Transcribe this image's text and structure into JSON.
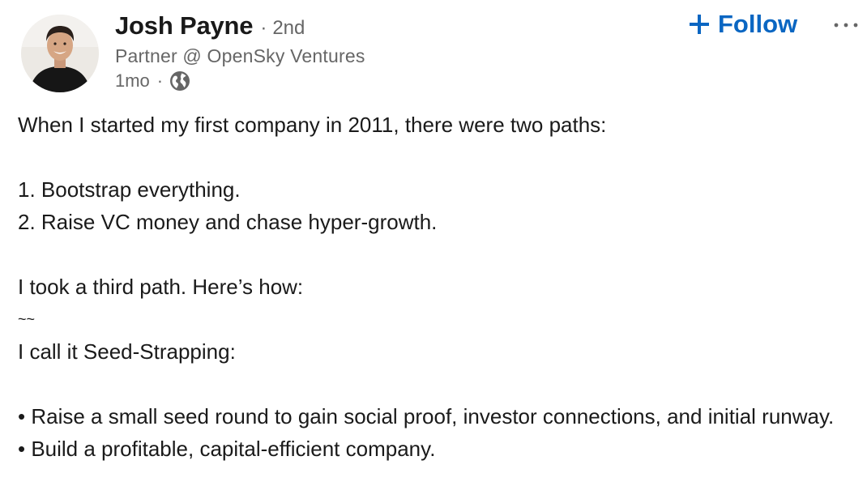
{
  "author": {
    "name": "Josh Payne",
    "degree_separator": "·",
    "degree": "2nd",
    "headline": "Partner @ OpenSky Ventures",
    "time": "1mo",
    "meta_separator": "·",
    "visibility_icon": "globe-icon",
    "avatar_icon": "avatar-photo"
  },
  "actions": {
    "follow_label": "Follow",
    "follow_icon": "plus-icon",
    "more_icon": "more-horizontal-icon"
  },
  "colors": {
    "accent": "#0a66c2",
    "text_primary": "#1a1a1a",
    "text_secondary": "#666666"
  },
  "post": {
    "lines": [
      "When I started my first company in 2011, there were two paths:",
      "",
      "1. Bootstrap everything.",
      "2. Raise VC money and chase hyper-growth.",
      "",
      "I took a third path. Here’s how:",
      "~~",
      "I call it Seed-Strapping:",
      "",
      "• Raise a small seed round to gain social proof, investor connections, and initial runway.",
      "• Build a profitable, capital-efficient company."
    ]
  }
}
